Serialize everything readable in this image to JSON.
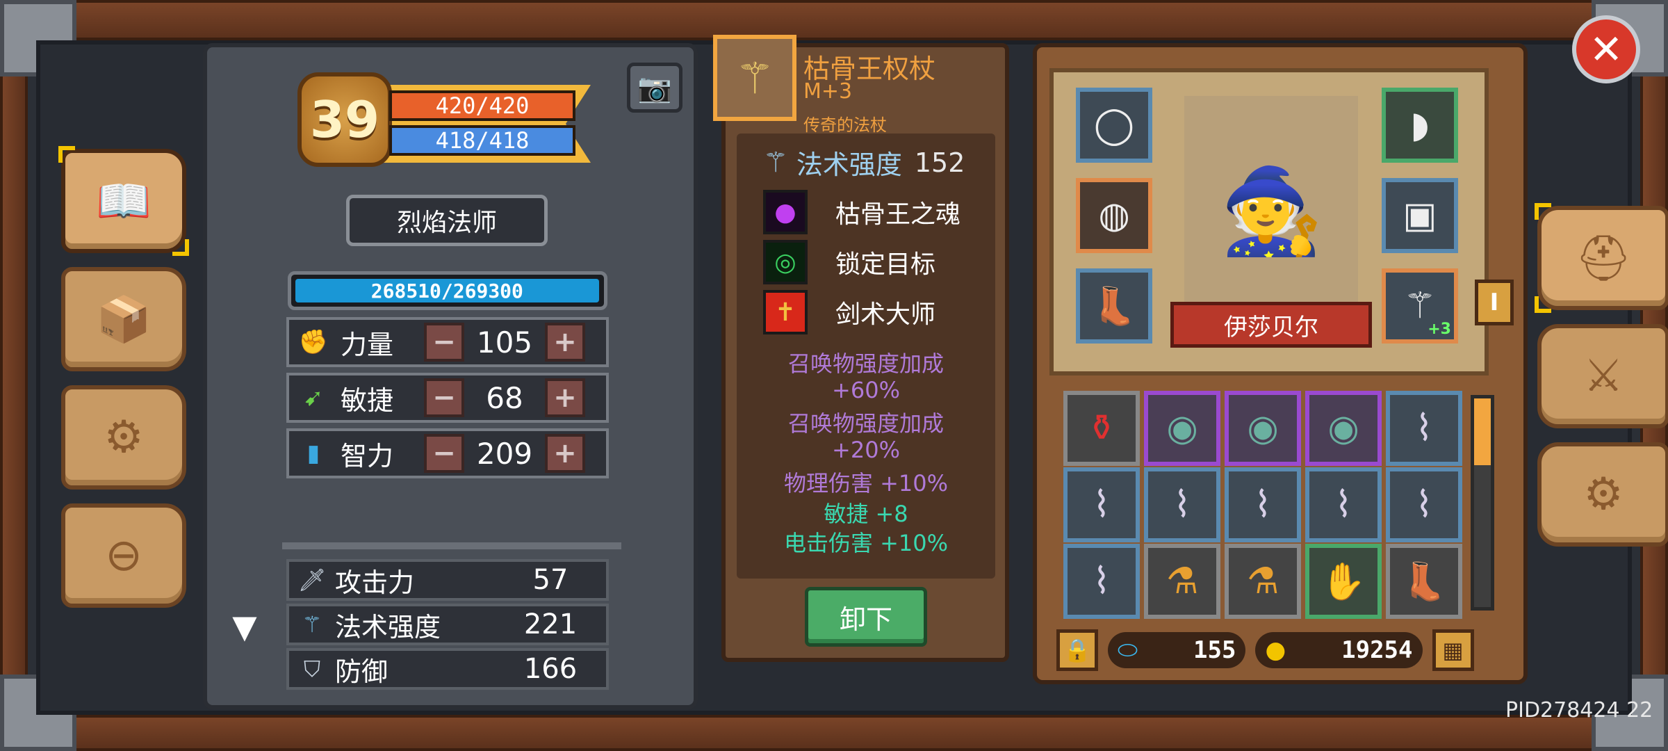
{
  "character": {
    "level": "39",
    "hp": "420/420",
    "mp": "418/418",
    "class_name": "烈焰法师",
    "xp_text": "268510/269300",
    "xp_fraction": 0.997,
    "stats": [
      {
        "label": "力量",
        "value": "105",
        "icon": "fist-icon"
      },
      {
        "label": "敏捷",
        "value": "68",
        "icon": "feather-icon"
      },
      {
        "label": "智力",
        "value": "209",
        "icon": "book-icon"
      }
    ],
    "attributes": [
      {
        "label": "攻击力",
        "value": "57",
        "icon": "sword-icon"
      },
      {
        "label": "法术强度",
        "value": "221",
        "icon": "wand-icon"
      },
      {
        "label": "防御",
        "value": "166",
        "icon": "shield-icon"
      }
    ],
    "minus_symbol": "−",
    "plus_symbol": "+"
  },
  "item": {
    "name": "枯骨王权杖",
    "upgrade": "M+3",
    "rarity": "传奇的法杖",
    "power_label": "法术强度",
    "power_value": "152",
    "skills": [
      {
        "label": "枯骨王之魂",
        "icon": "soul-flame-icon",
        "color": "#b030e0"
      },
      {
        "label": "锁定目标",
        "icon": "target-icon",
        "color": "#2ab050"
      },
      {
        "label": "剑术大师",
        "icon": "sword-crest-icon",
        "color": "#d8281a"
      }
    ],
    "bonuses": [
      {
        "text": "召唤物强度加成",
        "color": "#b07ad8"
      },
      {
        "text": "+60%",
        "color": "#b07ad8"
      },
      {
        "text": "召唤物强度加成",
        "color": "#b07ad8"
      },
      {
        "text": "+20%",
        "color": "#b07ad8"
      },
      {
        "text": "物理伤害 +10%",
        "color": "#b07ad8"
      },
      {
        "text": "敏捷 +8",
        "color": "#3ad8b0"
      },
      {
        "text": "电击伤害 +10%",
        "color": "#3ad8b0"
      }
    ],
    "unequip_label": "卸下"
  },
  "hero": {
    "name": "伊莎贝尔",
    "staff_plus": "+3",
    "handle_label": "I"
  },
  "currency": {
    "gems": "155",
    "gold": "19254"
  },
  "footer": {
    "pid": "PID278424  22"
  },
  "colors": {
    "accent": "#f2a640",
    "hp": "#e8612a",
    "mp": "#4a8be0",
    "xp": "#1a97d6",
    "unequip": "#4bac67",
    "close": "#d8382a"
  }
}
